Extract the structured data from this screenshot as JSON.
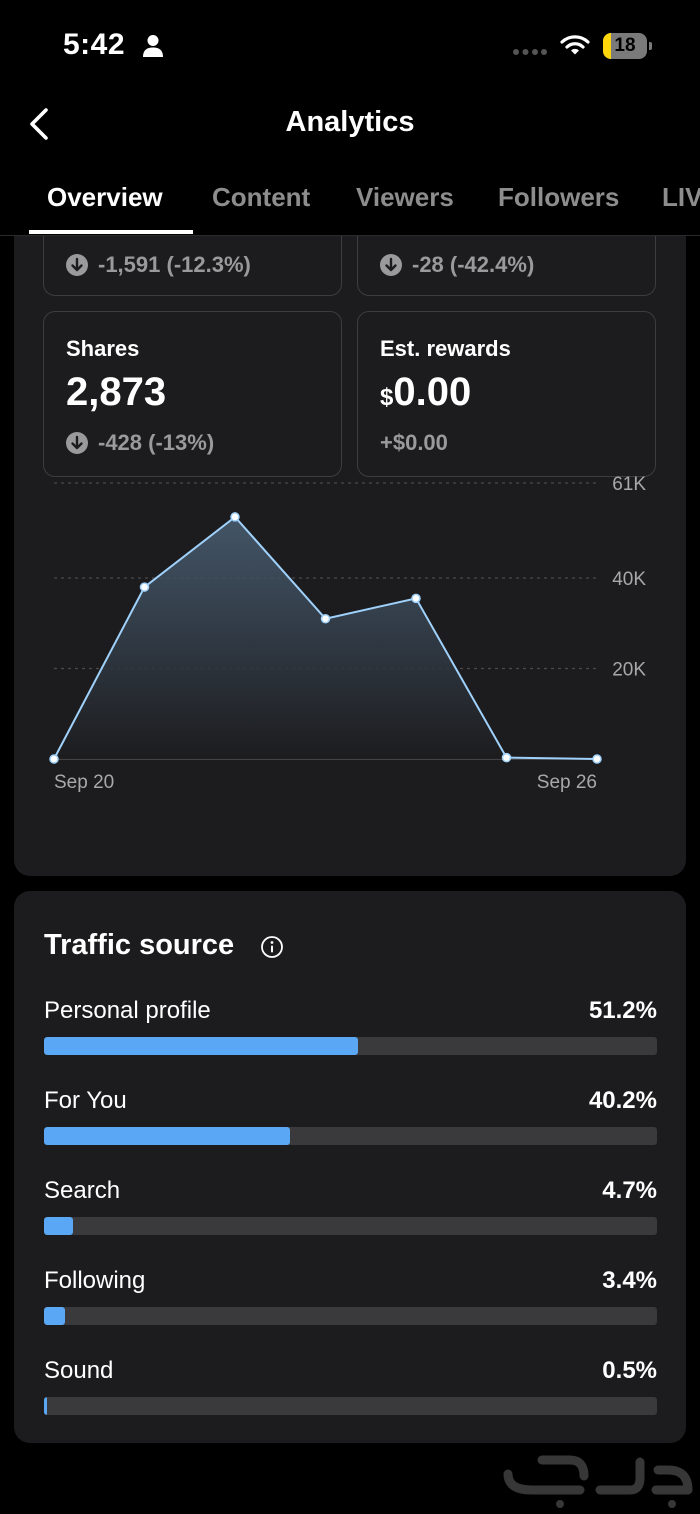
{
  "status_bar": {
    "time": "5:42",
    "battery_level": "18",
    "battery_fraction": 0.18,
    "icons": [
      "person-icon",
      "cellular-signal-icon",
      "wifi-icon",
      "battery-icon"
    ]
  },
  "header": {
    "title": "Analytics",
    "back_icon": "chevron-left-icon"
  },
  "tabs": [
    {
      "label": "Overview",
      "active": true
    },
    {
      "label": "Content",
      "active": false
    },
    {
      "label": "Viewers",
      "active": false
    },
    {
      "label": "Followers",
      "active": false
    },
    {
      "label": "LIVE",
      "active": false
    }
  ],
  "metrics": [
    {
      "id": "partial-left",
      "change": "-1,591 (-12.3%)",
      "direction": "down"
    },
    {
      "id": "partial-right",
      "change": "-28 (-42.4%)",
      "direction": "down"
    },
    {
      "id": "shares",
      "label": "Shares",
      "value": "2,873",
      "change": "-428 (-13%)",
      "direction": "down"
    },
    {
      "id": "est-rewards",
      "label": "Est. rewards",
      "currency": "$",
      "value": "0.00",
      "change": "+$0.00",
      "direction": "flat"
    }
  ],
  "chart_data": {
    "type": "area",
    "x": [
      "Sep 20",
      "Sep 21",
      "Sep 22",
      "Sep 23",
      "Sep 24",
      "Sep 25",
      "Sep 26"
    ],
    "values": [
      0,
      38000,
      53500,
      31000,
      35500,
      300,
      0
    ],
    "x_tick_labels": [
      "Sep 20",
      "Sep 26"
    ],
    "y_ticks": [
      20000,
      40000,
      61000
    ],
    "y_tick_labels": [
      "20K",
      "40K",
      "61K"
    ],
    "ylim": [
      0,
      61000
    ],
    "grid": true,
    "line_color": "#9fd1fb"
  },
  "traffic_source": {
    "title": "Traffic source",
    "info_icon": "info-icon",
    "items": [
      {
        "label": "Personal profile",
        "percent": "51.2%",
        "value": 0.512
      },
      {
        "label": "For You",
        "percent": "40.2%",
        "value": 0.402
      },
      {
        "label": "Search",
        "percent": "4.7%",
        "value": 0.047
      },
      {
        "label": "Following",
        "percent": "3.4%",
        "value": 0.034
      },
      {
        "label": "Sound",
        "percent": "0.5%",
        "value": 0.005
      }
    ],
    "bar_color": "#5aa8f5"
  },
  "watermark": {
    "text": "حراج"
  }
}
